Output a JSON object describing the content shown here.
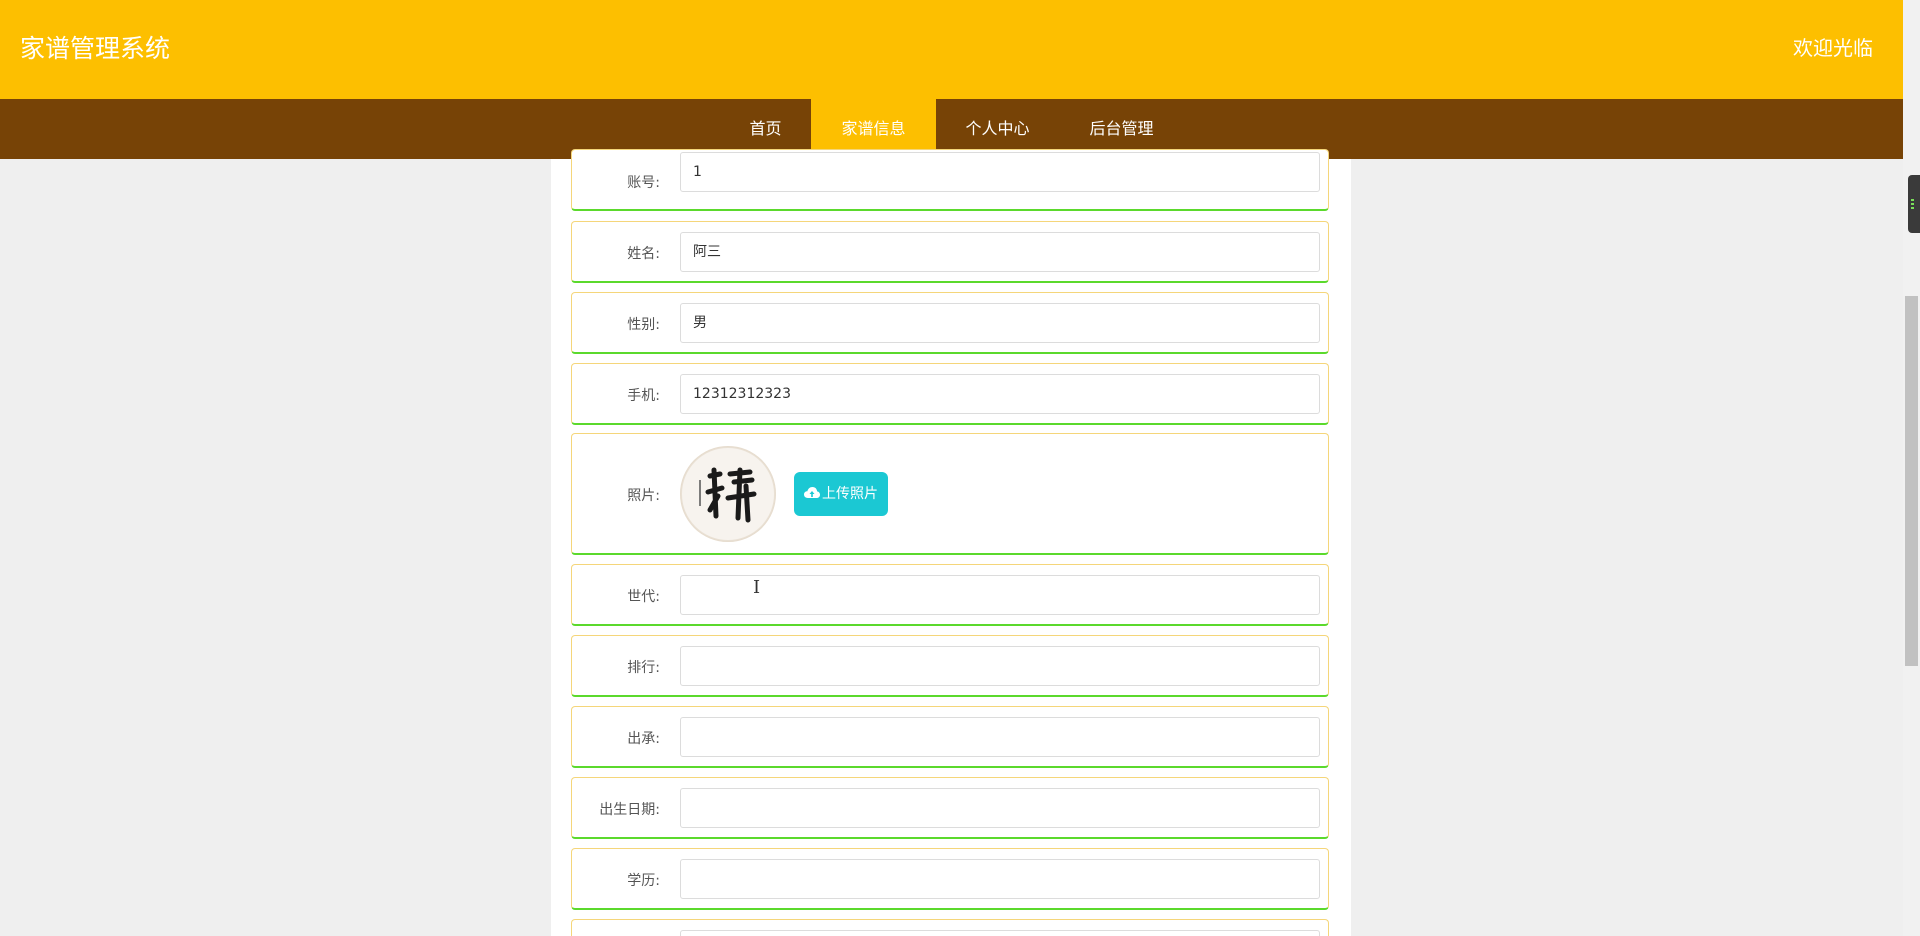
{
  "header": {
    "title": "家谱管理系统",
    "welcome": "欢迎光临"
  },
  "nav": {
    "items": [
      "首页",
      "家谱信息",
      "个人中心",
      "后台管理"
    ],
    "active_index": 1
  },
  "form": {
    "account": {
      "label": "账号:",
      "value": "1"
    },
    "name": {
      "label": "姓名:",
      "value": "阿三"
    },
    "gender": {
      "label": "性别:",
      "value": "男"
    },
    "phone": {
      "label": "手机:",
      "value": "12312312323"
    },
    "photo": {
      "label": "照片:",
      "upload_label": "上传照片"
    },
    "generation": {
      "label": "世代:",
      "value": ""
    },
    "rank": {
      "label": "排行:",
      "value": ""
    },
    "lineage": {
      "label": "出承:",
      "value": ""
    },
    "birth_date": {
      "label": "出生日期:",
      "value": ""
    },
    "education": {
      "label": "学历:",
      "value": ""
    }
  },
  "colors": {
    "header_bg": "#fdbf00",
    "nav_bg": "#774306",
    "nav_active_bg": "#fdbf00",
    "upload_button": "#1bc8d3",
    "row_border_bottom": "#5bd92c",
    "row_border": "#f5d67a"
  },
  "icons": {
    "upload": "cloud-upload-icon",
    "cursor": "text-cursor-icon"
  }
}
